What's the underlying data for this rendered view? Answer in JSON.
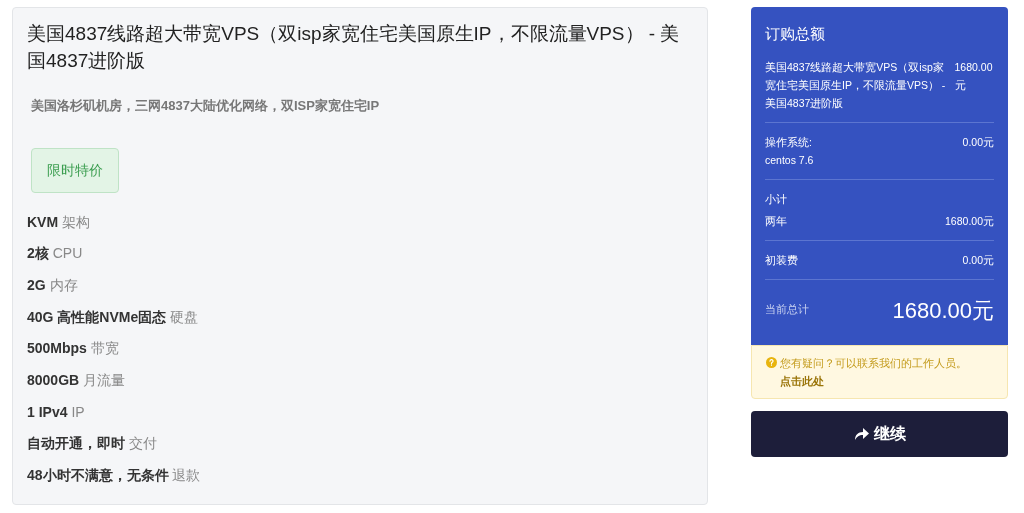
{
  "product": {
    "title": "美国4837线路超大带宽VPS（双isp家宽住宅美国原生IP，不限流量VPS） - 美国4837进阶版",
    "tagline": "美国洛杉矶机房，三网4837大陆优化网络，双ISP家宽住宅IP",
    "badge": "限时特价",
    "features": [
      {
        "value": "KVM",
        "label": "架构"
      },
      {
        "value": "2核",
        "label": "CPU"
      },
      {
        "value": "2G",
        "label": "内存"
      },
      {
        "value": "40G 高性能NVMe固态",
        "label": "硬盘"
      },
      {
        "value": "500Mbps",
        "label": "带宽"
      },
      {
        "value": "8000GB",
        "label": "月流量"
      },
      {
        "value": "1 IPv4",
        "label": "IP"
      },
      {
        "value": "自动开通，即时",
        "label": "交付"
      },
      {
        "value": "48小时不满意，无条件",
        "label": "退款"
      }
    ]
  },
  "summary": {
    "title": "订购总额",
    "item": {
      "name": "美国4837线路超大带宽VPS（双isp家宽住宅美国原生IP，不限流量VPS） - 美国4837进阶版",
      "price": "1680.00元"
    },
    "os": {
      "label": "操作系统:",
      "value": "centos 7.6",
      "price": "0.00元"
    },
    "subtotal_label": "小计",
    "cycle": {
      "label": "两年",
      "price": "1680.00元"
    },
    "setup": {
      "label": "初装费",
      "price": "0.00元"
    },
    "total": {
      "label": "当前总计",
      "amount": "1680.00元"
    }
  },
  "help": {
    "text": "您有疑问？可以联系我们的工作人员。",
    "link": "点击此处"
  },
  "continue_button": "继续"
}
